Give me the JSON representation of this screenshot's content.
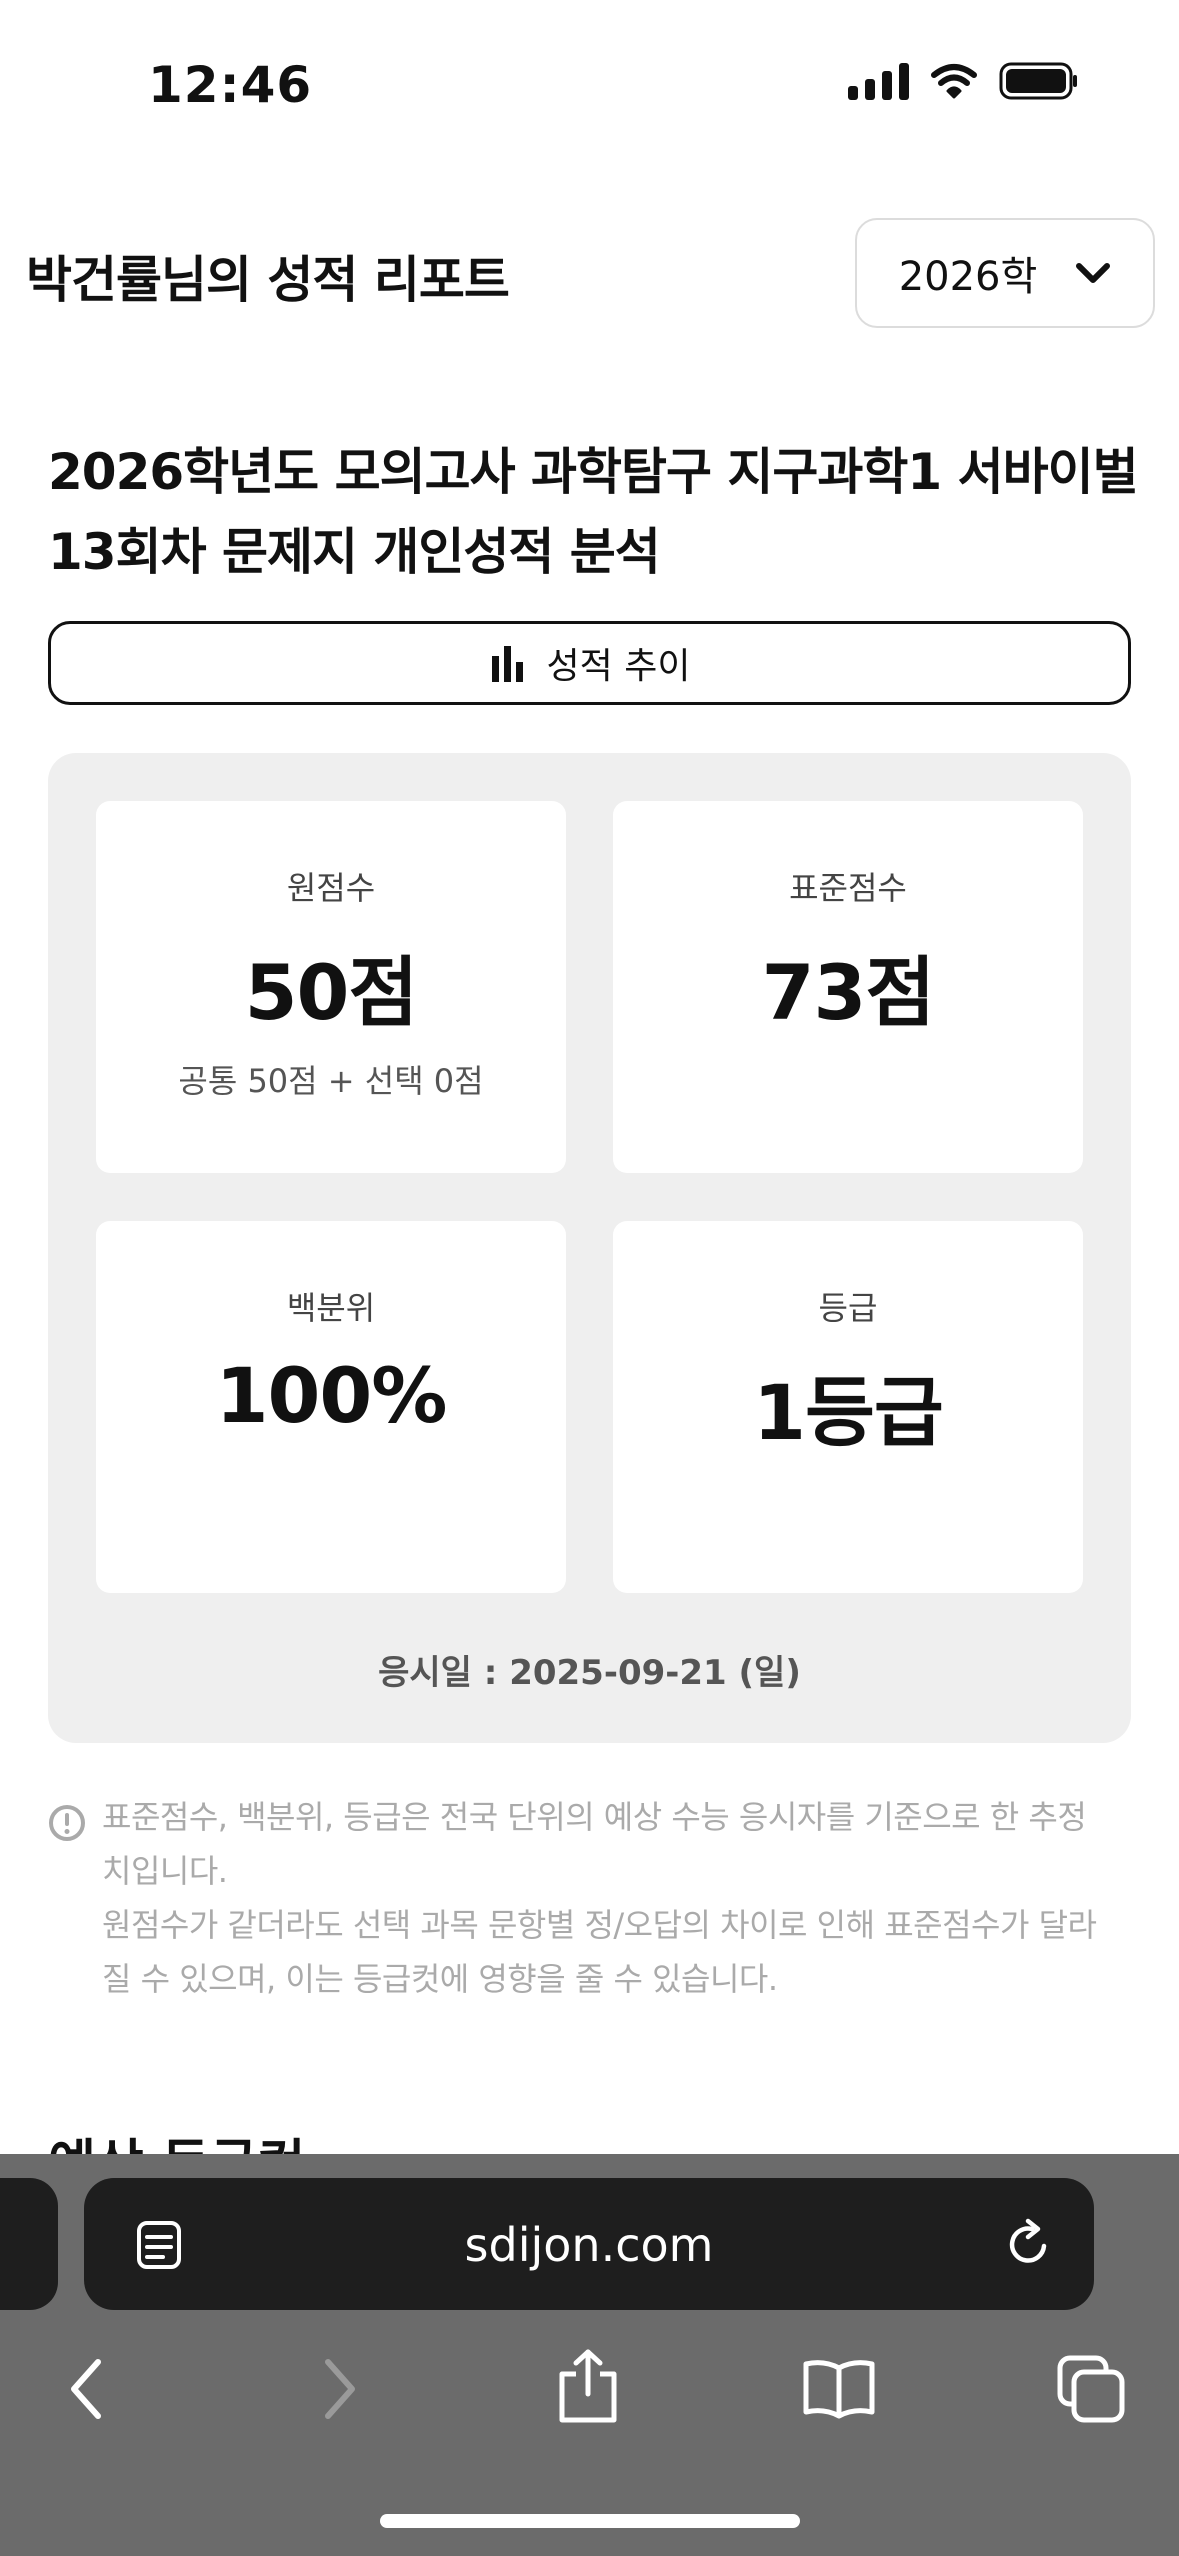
{
  "status_bar": {
    "time": "12:46"
  },
  "header": {
    "report_title": "박건률님의 성적 리포트",
    "exam_select": {
      "selected": "2026학"
    }
  },
  "exam": {
    "name": "2026학년도 모의고사 과학탐구 지구과학1 서바이벌 13회차 문제지 개인성적 분석"
  },
  "trend_button": {
    "label": "성적 추이"
  },
  "scores": {
    "raw": {
      "label": "원점수",
      "value": "50점",
      "detail": "공통 50점 + 선택 0점"
    },
    "standard": {
      "label": "표준점수",
      "value": "73점"
    },
    "percentile": {
      "label": "백분위",
      "value": "100%"
    },
    "grade": {
      "label": "등급",
      "value": "1등급"
    },
    "exam_date": "응시일 : 2025-09-21 (일)"
  },
  "notice": {
    "line1": "표준점수, 백분위, 등급은 전국 단위의 예상 수능 응시자를 기준으로 한 추정치입니다.",
    "line2": "원점수가 같더라도 선택 과목 문항별 정/오답의 차이로 인해 표준점수가 달라질 수 있으며, 이는 등급컷에 영향을 줄 수 있습니다."
  },
  "next_section": {
    "heading": "예상 등급컷"
  },
  "browser": {
    "url": "sdijon.com"
  },
  "icons": {
    "chevron": "chevron-down-icon",
    "chart": "bar-chart-icon",
    "notice": "exclamation-circle-icon",
    "reader": "reader-mode-icon",
    "reload": "reload-icon",
    "back": "back-icon",
    "forward": "forward-icon",
    "share": "share-icon",
    "bookmarks": "bookmarks-icon",
    "tabs": "tabs-icon"
  },
  "colors": {
    "panel_bg": "#efefef",
    "card_bg": "#ffffff",
    "notice_text": "#aaaaaa",
    "browser_bar": "#6b6b6b",
    "url_bar": "#1e1e1e"
  }
}
